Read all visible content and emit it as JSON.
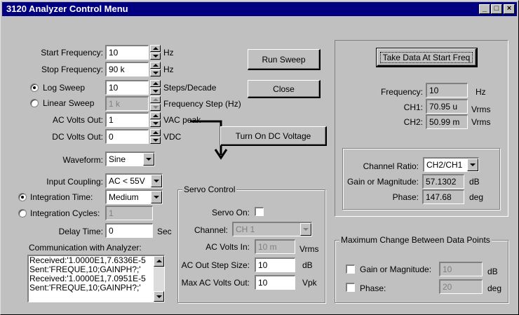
{
  "window": {
    "title": "3120 Analyzer Control Menu",
    "min_glyph": "_",
    "max_glyph": "□",
    "close_glyph": "×"
  },
  "sweep": {
    "start_frequency": {
      "label": "Start Frequency:",
      "value": "10",
      "unit": "Hz"
    },
    "stop_frequency": {
      "label": "Stop Frequency:",
      "value": "90 k",
      "unit": "Hz"
    },
    "log_sweep": {
      "label": "Log Sweep",
      "value": "10",
      "unit": "Steps/Decade",
      "selected": true
    },
    "linear_sweep": {
      "label": "Linear Sweep",
      "value": "1 k",
      "unit": "Frequency Step (Hz)",
      "selected": false
    },
    "ac_volts_out": {
      "label": "AC Volts Out:",
      "value": "1",
      "unit": "VAC peak"
    },
    "dc_volts_out": {
      "label": "DC Volts Out:",
      "value": "0",
      "unit": "VDC"
    },
    "waveform": {
      "label": "Waveform:",
      "value": "Sine"
    }
  },
  "buttons": {
    "run_sweep": "Run Sweep",
    "close": "Close",
    "turn_on_dc": "Turn On DC Voltage",
    "take_data": "Take Data At Start Freq"
  },
  "input": {
    "coupling": {
      "label": "Input Coupling:",
      "value": "AC < 55V"
    },
    "integration_time": {
      "label": "Integration Time:",
      "value": "Medium",
      "selected": true
    },
    "integration_cycles": {
      "label": "Integration Cycles:",
      "value": "1",
      "selected": false
    },
    "delay_time": {
      "label": "Delay Time:",
      "value": "0",
      "unit": "Sec"
    }
  },
  "communication": {
    "label": "Communication with Analyzer:",
    "lines": [
      "Received:'1.0000E1,7.6336E-5",
      "Sent:'FREQUE,10;GAINPH?;'",
      "Received:'1.0000E1,7.0951E-5",
      "Sent:'FREQUE,10;GAINPH?;'"
    ]
  },
  "servo": {
    "title": "Servo Control",
    "servo_on": {
      "label": "Servo On:",
      "checked": false
    },
    "channel": {
      "label": "Channel:",
      "value": "CH 1"
    },
    "ac_volts_in": {
      "label": "AC Volts In:",
      "value": "10 m",
      "unit": "Vrms"
    },
    "ac_out_step_size": {
      "label": "AC Out Step Size:",
      "value": "10",
      "unit": "dB"
    },
    "max_ac_volts_out": {
      "label": "Max AC Volts Out:",
      "value": "10",
      "unit": "Vpk"
    }
  },
  "readout": {
    "frequency": {
      "label": "Frequency:",
      "value": "10",
      "unit": "Hz"
    },
    "ch1": {
      "label": "CH1:",
      "value": "70.95 u",
      "unit": "Vrms"
    },
    "ch2": {
      "label": "CH2:",
      "value": "50.99 m",
      "unit": "Vrms"
    }
  },
  "ratio": {
    "channel_ratio": {
      "label": "Channel Ratio:",
      "value": "CH2/CH1"
    },
    "gain": {
      "label": "Gain or Magnitude:",
      "value": "57.1302",
      "unit": "dB"
    },
    "phase": {
      "label": "Phase:",
      "value": "147.68",
      "unit": "deg"
    }
  },
  "max_change": {
    "title": "Maximum Change Between Data Points",
    "gain": {
      "label": "Gain or Magnitude:",
      "value": "10",
      "unit": "dB",
      "checked": false
    },
    "phase": {
      "label": "Phase:",
      "value": "20",
      "unit": "deg",
      "checked": false
    }
  },
  "icons": {
    "arrow": "down-arrow-icon"
  }
}
